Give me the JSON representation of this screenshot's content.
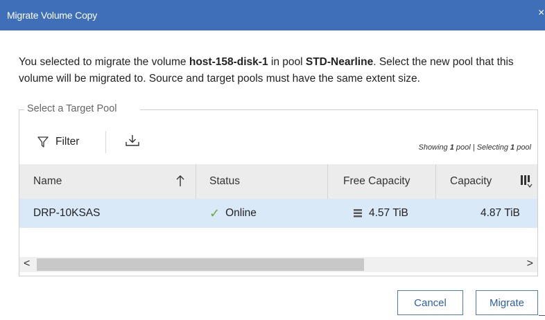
{
  "dialog": {
    "title": "Migrate Volume Copy",
    "close_glyph": "×",
    "description": {
      "part1": "You selected to migrate the volume ",
      "volume": "host-158-disk-1",
      "part2": " in pool ",
      "pool": "STD-Nearline",
      "part3": ". Select the new pool that this volume will be migrated to. Source and target pools must have the same extent size."
    }
  },
  "target_pool": {
    "legend": "Select a Target Pool",
    "toolbar": {
      "filter_label": "Filter",
      "filter_icon": "filter-icon",
      "download_icon": "download-icon"
    },
    "status": {
      "showing_prefix": "Showing ",
      "showing_count": "1",
      "showing_suffix": " pool | Selecting ",
      "selecting_count": "1",
      "selecting_suffix": " pool"
    },
    "table": {
      "columns": [
        "Name",
        "Status",
        "Free Capacity",
        "Capacity"
      ],
      "sort_icon": "arrow-up-icon",
      "column_picker_icon": "columns-icon",
      "rows": [
        {
          "name": "DRP-10KSAS",
          "status": "Online",
          "status_icon": "checkmark-icon",
          "free_capacity": "4.57 TiB",
          "capacity": "4.87 TiB",
          "selected": true
        }
      ]
    },
    "scrollbar": {
      "left_arrow": "<",
      "right_arrow": ">"
    }
  },
  "buttons": {
    "cancel": "Cancel",
    "migrate": "Migrate"
  },
  "colors": {
    "title_bar": "#3e6fb8",
    "selected_row": "#d9e9f8",
    "online_check": "#6aab3a",
    "button_border": "#4a78c1"
  }
}
